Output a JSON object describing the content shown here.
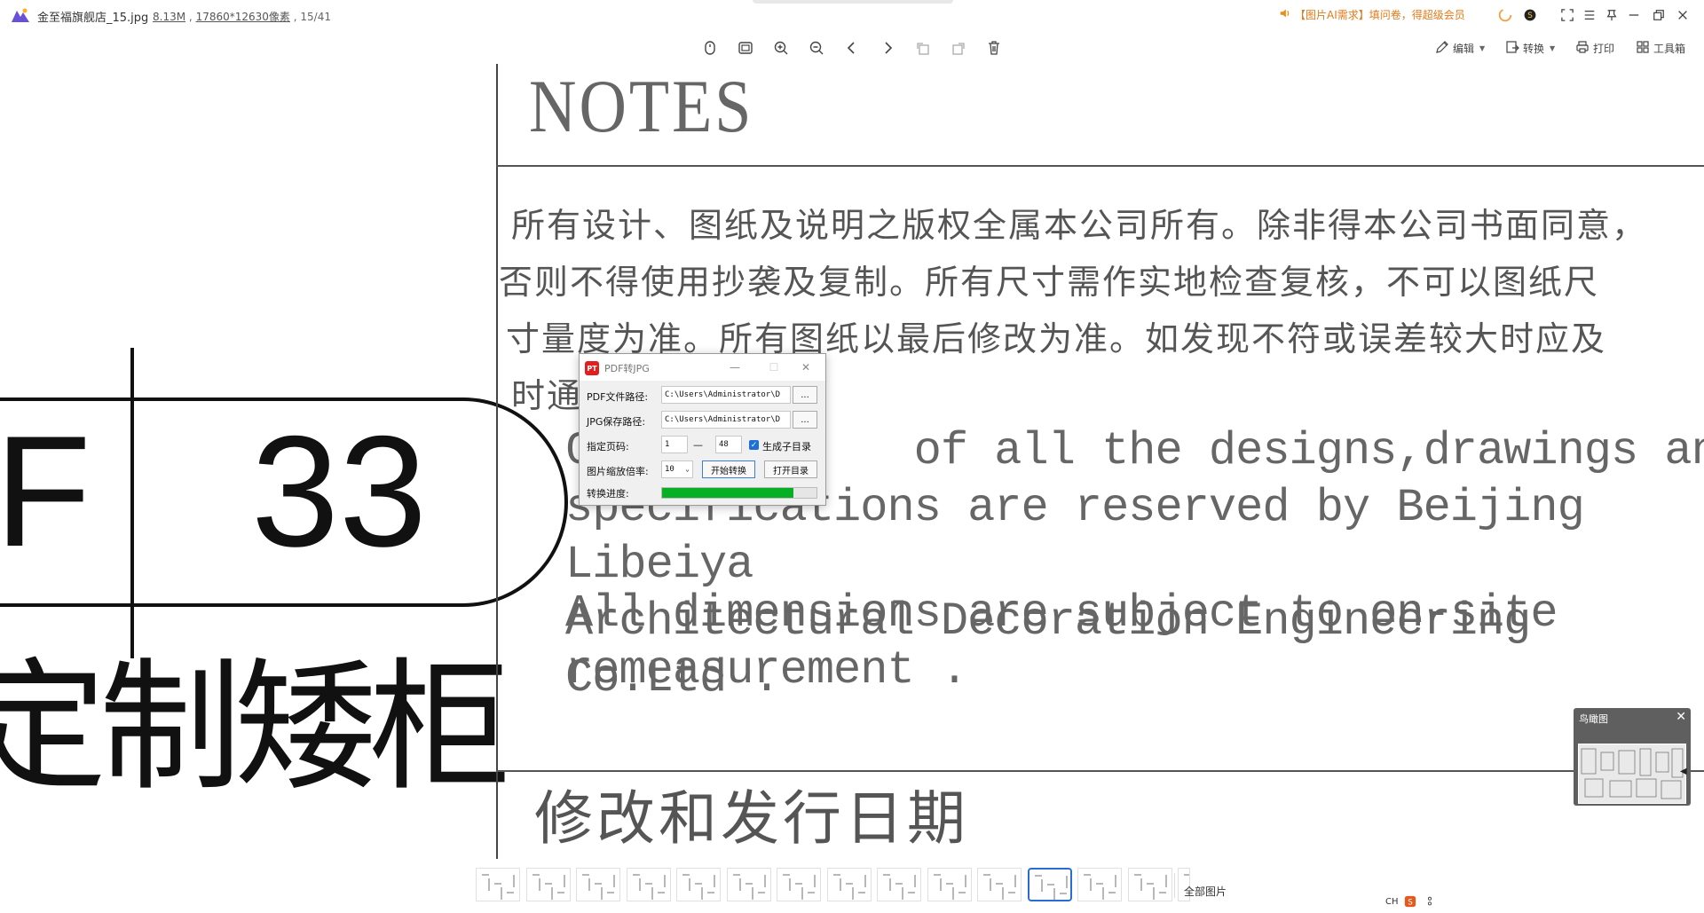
{
  "titlebar": {
    "filename": "金至福旗舰店_15.jpg",
    "filesize": "8.13M",
    "resolution": "17860*12630像素",
    "position": "15/41",
    "promo": "【图片AI需求】填问卷，得超级会员"
  },
  "toolbar": {
    "tools": [
      "pan-icon",
      "fit-window-icon",
      "zoom-in-icon",
      "zoom-out-icon",
      "prev-image-icon",
      "next-image-icon",
      "rotate-left-icon",
      "rotate-right-icon",
      "delete-icon"
    ],
    "edit_label": "编辑",
    "convert_label": "转换",
    "print_label": "打印",
    "toolbox_label": "工具箱"
  },
  "drawing": {
    "badge_letter": "F",
    "badge_number": "33",
    "big_title": "定制矮柜",
    "notes_title": "NOTES",
    "cn_lines": [
      "所有设计、图纸及说明之版权全属本公司所有。除非得本公司书面同意，",
      "否则不得使用抄袭及复制。所有尺寸需作实地检查复核，不可以图纸尺",
      "寸量度为准。所有图纸以最后修改为准。如发现不符或误差较大时应及",
      "时通"
    ],
    "en_lines": [
      "C            of all the designs,drawings and",
      "specifications are reserved by Beijing Libeiya",
      "Architectural Decoration Engineering Co.Ltd ."
    ],
    "en_lines2": [
      "All dimensions are subject to on-site",
      "remeasurement ."
    ],
    "bottom_heading": "修改和发行日期"
  },
  "dialog": {
    "title": "PDF转JPG",
    "pdf_label": "PDF文件路径:",
    "pdf_path": "C:\\Users\\Administrator\\D",
    "jpg_label": "JPG保存路径:",
    "jpg_path": "C:\\Users\\Administrator\\D",
    "browse": "...",
    "page_label": "指定页码:",
    "page_from": "1",
    "page_dash": "—",
    "page_to": "48",
    "subdir_label": "生成子目录",
    "subdir_checked": true,
    "scale_label": "图片缩放倍率:",
    "scale_value": "10",
    "start_button": "开始转换",
    "open_button": "打开目录",
    "progress_label": "转换进度:",
    "progress_fraction": 0.85
  },
  "minimap": {
    "title": "鸟瞰图"
  },
  "filmstrip": {
    "count": 15,
    "active_index": 11,
    "all_images": "全部图片"
  },
  "tray": {
    "ime": "CH"
  }
}
